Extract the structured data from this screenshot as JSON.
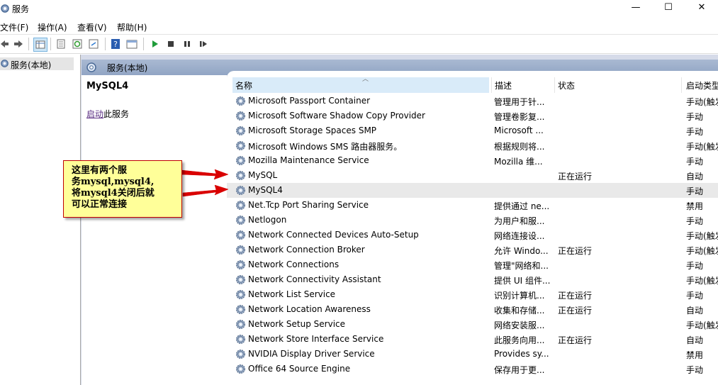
{
  "window": {
    "title": "服务",
    "minimize": "—",
    "maximize": "☐",
    "close": "✕"
  },
  "menu": [
    "文件(F)",
    "操作(A)",
    "查看(V)",
    "帮助(H)"
  ],
  "tree": {
    "item": "服务(本地)"
  },
  "header": {
    "title": "服务(本地)"
  },
  "detail": {
    "service_name": "MySQL4",
    "start_link": "启动",
    "start_suffix": "此服务"
  },
  "columns": {
    "name": "名称",
    "description": "描述",
    "status": "状态",
    "startup": "启动类型"
  },
  "rows": [
    {
      "name": "Microsoft Passport Container",
      "desc": "管理用于针...",
      "status": "",
      "startup": "手动(触发"
    },
    {
      "name": "Microsoft Software Shadow Copy Provider",
      "desc": "管理卷影复...",
      "status": "",
      "startup": "手动"
    },
    {
      "name": "Microsoft Storage Spaces SMP",
      "desc": "Microsoft ...",
      "status": "",
      "startup": "手动"
    },
    {
      "name": "Microsoft Windows SMS 路由器服务。",
      "desc": "根据规则将...",
      "status": "",
      "startup": "手动(触发"
    },
    {
      "name": "Mozilla Maintenance Service",
      "desc": "Mozilla 维...",
      "status": "",
      "startup": "手动"
    },
    {
      "name": "MySQL",
      "desc": "",
      "status": "正在运行",
      "startup": "自动"
    },
    {
      "name": "MySQL4",
      "desc": "",
      "status": "",
      "startup": "手动"
    },
    {
      "name": "Net.Tcp Port Sharing Service",
      "desc": "提供通过 ne...",
      "status": "",
      "startup": "禁用"
    },
    {
      "name": "Netlogon",
      "desc": "为用户和服...",
      "status": "",
      "startup": "手动"
    },
    {
      "name": "Network Connected Devices Auto-Setup",
      "desc": "网络连接设...",
      "status": "",
      "startup": "手动(触发"
    },
    {
      "name": "Network Connection Broker",
      "desc": "允许 Windo...",
      "status": "正在运行",
      "startup": "手动(触发"
    },
    {
      "name": "Network Connections",
      "desc": "管理\"网络和...",
      "status": "",
      "startup": "手动"
    },
    {
      "name": "Network Connectivity Assistant",
      "desc": "提供 UI 组件...",
      "status": "",
      "startup": "手动(触发"
    },
    {
      "name": "Network List Service",
      "desc": "识别计算机...",
      "status": "正在运行",
      "startup": "手动"
    },
    {
      "name": "Network Location Awareness",
      "desc": "收集和存储...",
      "status": "正在运行",
      "startup": "自动"
    },
    {
      "name": "Network Setup Service",
      "desc": "网络安装服...",
      "status": "",
      "startup": "手动(触发"
    },
    {
      "name": "Network Store Interface Service",
      "desc": "此服务向用...",
      "status": "正在运行",
      "startup": "自动"
    },
    {
      "name": "NVIDIA Display Driver Service",
      "desc": "Provides sy...",
      "status": "",
      "startup": "禁用"
    },
    {
      "name": "Office 64 Source Engine",
      "desc": "保存用于更...",
      "status": "",
      "startup": "手动"
    }
  ],
  "annotation": {
    "text": "这里有两个服\n务mysql,mysql4,\n将mysql4关闭后就\n可以正常连接"
  },
  "colors": {
    "header_bar": "#a9b9d2",
    "callout_fill": "#ffff99",
    "arrow": "#d90000",
    "selected_row": "#e9e9e9"
  }
}
